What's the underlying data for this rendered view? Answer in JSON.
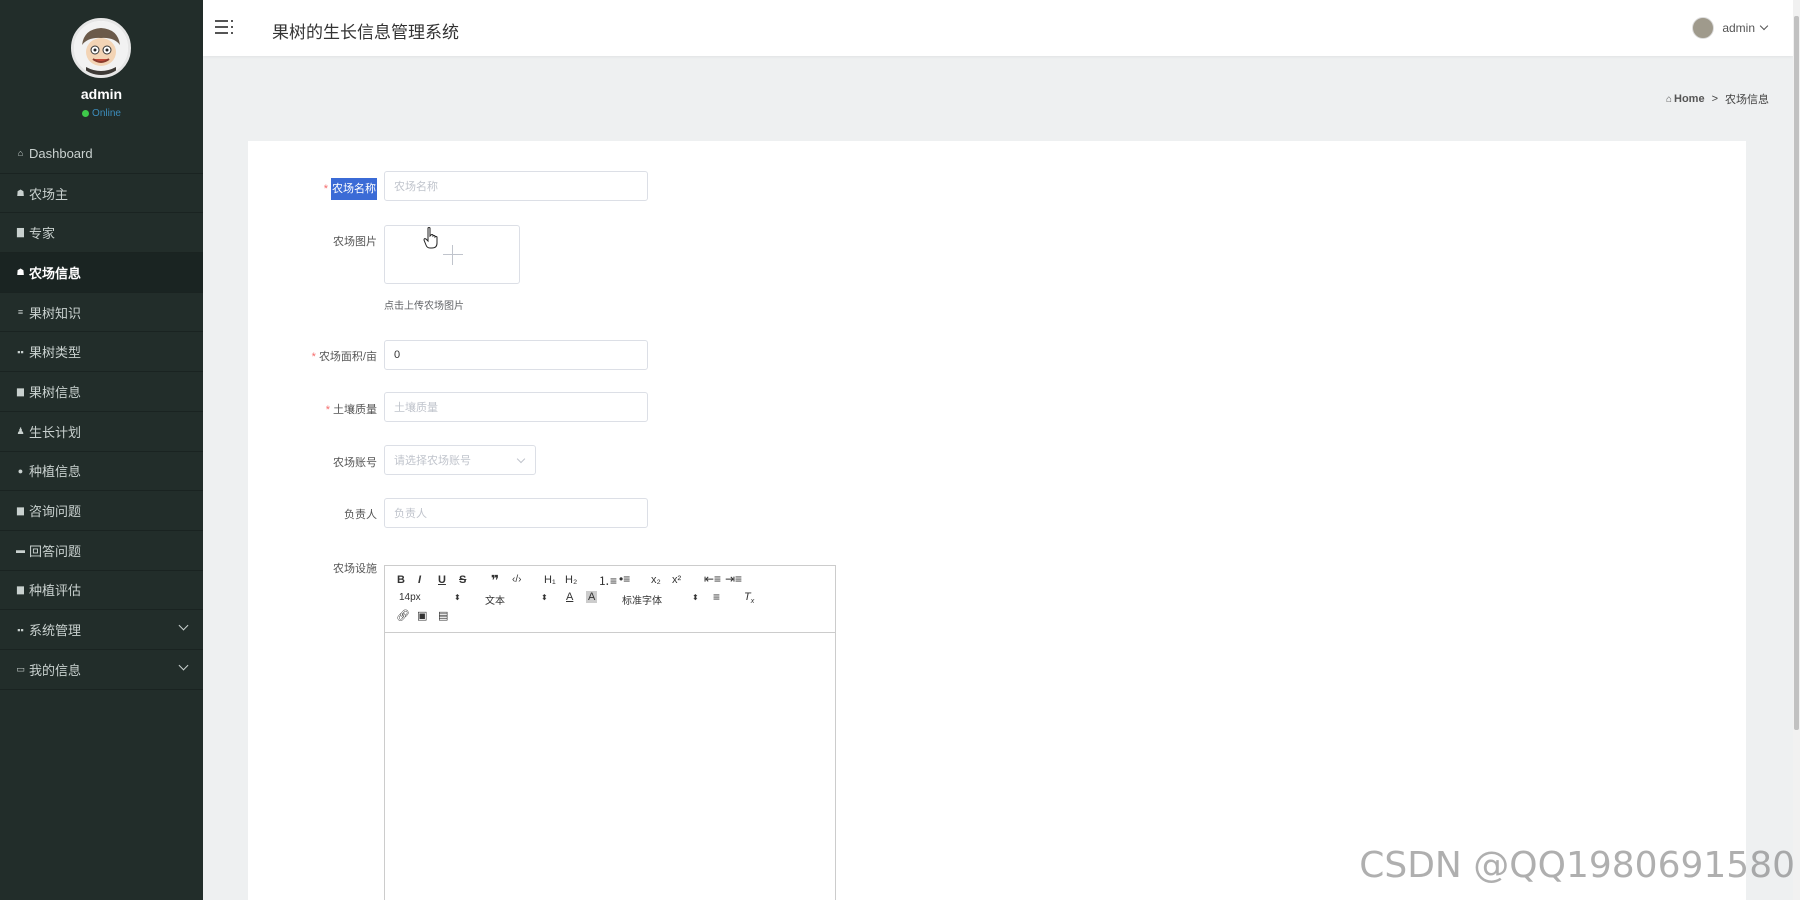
{
  "sidebar": {
    "username": "admin",
    "status": "Online",
    "menu": [
      {
        "icon": "home-icon",
        "glyph": "⌂",
        "label": "Dashboard",
        "active": false
      },
      {
        "icon": "farmer-icon",
        "glyph": "☗",
        "label": "农场主",
        "active": false
      },
      {
        "icon": "expert-icon",
        "glyph": "▇",
        "label": "专家",
        "active": false
      },
      {
        "icon": "farm-info-icon",
        "glyph": "☗",
        "label": "农场信息",
        "active": true
      },
      {
        "icon": "list-icon",
        "glyph": "≡",
        "label": "果树知识",
        "active": false
      },
      {
        "icon": "grid-icon",
        "glyph": "▪▪",
        "label": "果树类型",
        "active": false
      },
      {
        "icon": "doc-icon",
        "glyph": "▆",
        "label": "果树信息",
        "active": false
      },
      {
        "icon": "person-icon",
        "glyph": "♟",
        "label": "生长计划",
        "active": false
      },
      {
        "icon": "location-icon",
        "glyph": "●",
        "label": "种植信息",
        "active": false
      },
      {
        "icon": "doc-icon",
        "glyph": "▆",
        "label": "咨询问题",
        "active": false
      },
      {
        "icon": "chat-icon",
        "glyph": "▬",
        "label": "回答问题",
        "active": false
      },
      {
        "icon": "doc-icon",
        "glyph": "▆",
        "label": "种植评估",
        "active": false
      },
      {
        "icon": "grid-icon",
        "glyph": "▪▪",
        "label": "系统管理",
        "active": false,
        "expandable": true
      },
      {
        "icon": "card-icon",
        "glyph": "▭",
        "label": "我的信息",
        "active": false,
        "expandable": true
      }
    ]
  },
  "header": {
    "title": "果树的生长信息管理系统",
    "user": "admin"
  },
  "breadcrumb": {
    "home": "Home",
    "separator": ">",
    "current": "农场信息"
  },
  "form": {
    "farm_name": {
      "label": "农场名称",
      "placeholder": "农场名称",
      "value": "",
      "required": true
    },
    "farm_image": {
      "label": "农场图片",
      "tip": "点击上传农场图片"
    },
    "farm_area": {
      "label": "农场面积/亩",
      "value": "0",
      "required": true
    },
    "soil_quality": {
      "label": "土壤质量",
      "placeholder": "土壤质量",
      "value": "",
      "required": true
    },
    "farm_account": {
      "label": "农场账号",
      "placeholder": "请选择农场账号"
    },
    "manager": {
      "label": "负责人",
      "placeholder": "负责人"
    },
    "facilities": {
      "label": "农场设施"
    }
  },
  "editor": {
    "font_size": "14px",
    "text_style": "文本",
    "font_family": "标准字体"
  },
  "watermark": "CSDN @QQ1980691580",
  "colors": {
    "sidebar_bg": "#222d2a",
    "highlight": "#3b6bd6",
    "required": "#f56c6c"
  }
}
